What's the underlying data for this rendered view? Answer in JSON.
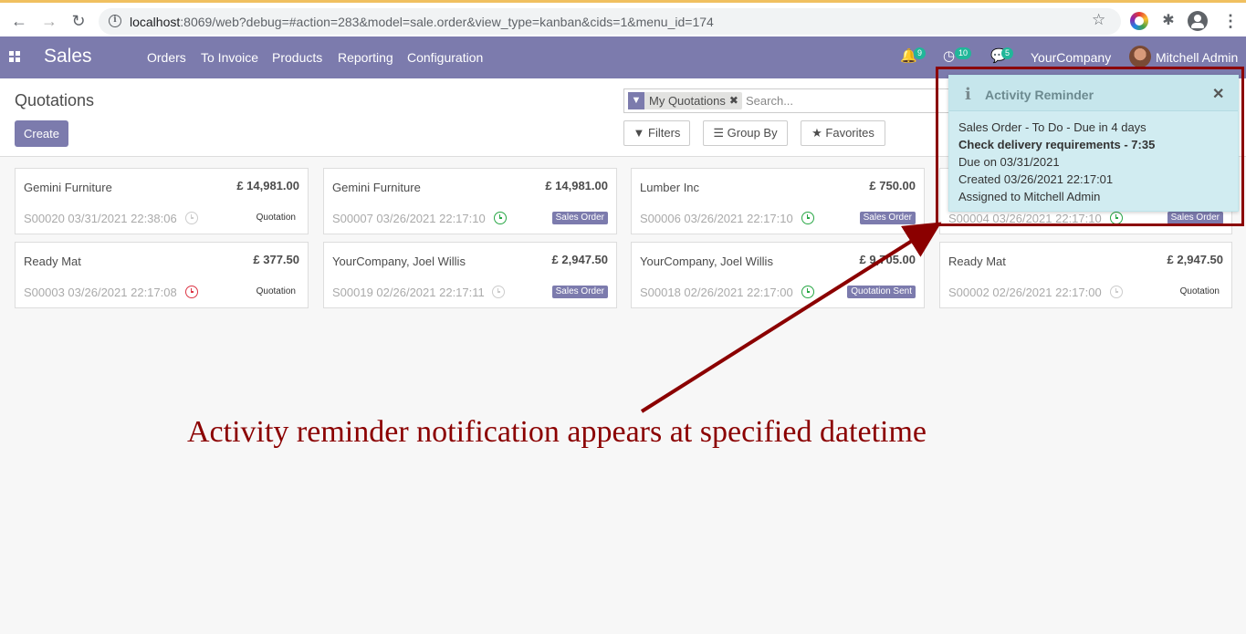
{
  "browser": {
    "url_host": "localhost",
    "url_rest": ":8069/web?debug=#action=283&model=sale.order&view_type=kanban&cids=1&menu_id=174"
  },
  "navbar": {
    "app_name": "Sales",
    "menu": [
      "Orders",
      "To Invoice",
      "Products",
      "Reporting",
      "Configuration"
    ],
    "notifications_count": "9",
    "activities_count": "10",
    "messages_count": "5",
    "company": "YourCompany",
    "user": "Mitchell Admin"
  },
  "control": {
    "title": "Quotations",
    "create_label": "Create",
    "facet_label": "My Quotations",
    "search_placeholder": "Search...",
    "filters_label": "Filters",
    "groupby_label": "Group By",
    "favorites_label": "Favorites"
  },
  "cards": [
    {
      "name": "Gemini Furniture",
      "amount": "£ 14,981.00",
      "ref": "S00020 03/31/2021 22:38:06",
      "activity": "grey",
      "status": "Quotation",
      "status_filled": false
    },
    {
      "name": "Gemini Furniture",
      "amount": "£ 14,981.00",
      "ref": "S00007 03/26/2021 22:17:10",
      "activity": "green",
      "status": "Sales Order",
      "status_filled": true
    },
    {
      "name": "Lumber Inc",
      "amount": "£ 750.00",
      "ref": "S00006 03/26/2021 22:17:10",
      "activity": "green",
      "status": "Sales Order",
      "status_filled": true
    },
    {
      "name": "",
      "amount": "",
      "ref": "S00004 03/26/2021 22:17:10",
      "activity": "green",
      "status": "Sales Order",
      "status_filled": true
    },
    {
      "name": "Ready Mat",
      "amount": "£ 377.50",
      "ref": "S00003 03/26/2021 22:17:08",
      "activity": "red",
      "status": "Quotation",
      "status_filled": false
    },
    {
      "name": "YourCompany, Joel Willis",
      "amount": "£ 2,947.50",
      "ref": "S00019 02/26/2021 22:17:11",
      "activity": "grey",
      "status": "Sales Order",
      "status_filled": true
    },
    {
      "name": "YourCompany, Joel Willis",
      "amount": "£ 9,705.00",
      "ref": "S00018 02/26/2021 22:17:00",
      "activity": "green",
      "status": "Quotation Sent",
      "status_filled": true
    },
    {
      "name": "Ready Mat",
      "amount": "£ 2,947.50",
      "ref": "S00002 02/26/2021 22:17:00",
      "activity": "grey",
      "status": "Quotation",
      "status_filled": false
    }
  ],
  "notification": {
    "title": "Activity Reminder",
    "line1": "Sales Order - To Do - Due in 4 days",
    "line2": "Check delivery requirements - 7:35",
    "line3": "Due on 03/31/2021",
    "line4": "Created 03/26/2021 22:17:01",
    "line5": "Assigned to Mitchell Admin"
  },
  "annotation": {
    "caption": "Activity reminder notification appears at specified datetime",
    "color": "#8b0000"
  },
  "colors": {
    "brand": "#7c7bad",
    "badge": "#21b799"
  }
}
